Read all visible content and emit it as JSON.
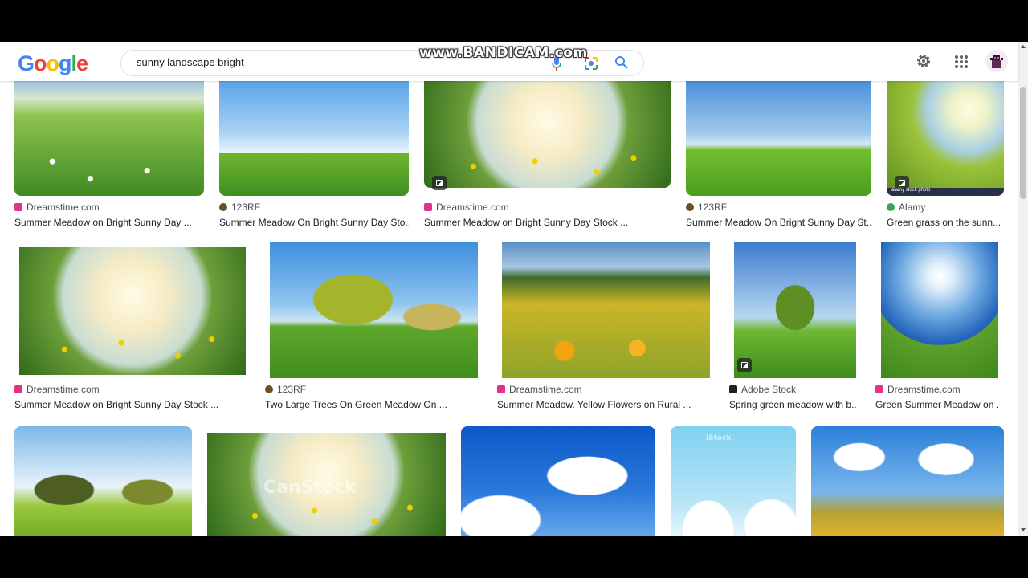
{
  "search": {
    "query": "sunny landscape bright"
  },
  "watermark": "www.BANDICAM.com",
  "logo": [
    "G",
    "o",
    "o",
    "g",
    "l",
    "e"
  ],
  "colors": {
    "source_icon_dreamstime": "#e0338a",
    "source_icon_123rf": "#6b4f2a",
    "source_icon_alamy": "#33a852",
    "source_icon_adobe": "#202124"
  },
  "results": [
    {
      "source": "Dreamstime.com",
      "title": "Summer Meadow on Bright Sunny Day ...",
      "icon": "dreamstime-icon"
    },
    {
      "source": "123RF",
      "title": "Summer Meadow On Bright Sunny Day Sto...",
      "icon": "123rf-icon"
    },
    {
      "source": "Dreamstime.com",
      "title": "Summer Meadow on Bright Sunny Day Stock ...",
      "icon": "dreamstime-icon"
    },
    {
      "source": "123RF",
      "title": "Summer Meadow On Bright Sunny Day St...",
      "icon": "123rf-icon"
    },
    {
      "source": "Alamy",
      "title": "Green grass on the sunn...",
      "icon": "alamy-icon",
      "overlay": "alamy stock photo"
    },
    {
      "source": "Dreamstime.com",
      "title": "Summer Meadow on Bright Sunny Day Stock ...",
      "icon": "dreamstime-icon"
    },
    {
      "source": "123RF",
      "title": "Two Large Trees On Green Meadow On ...",
      "icon": "123rf-icon"
    },
    {
      "source": "Dreamstime.com",
      "title": "Summer Meadow. Yellow Flowers on Rural ...",
      "icon": "dreamstime-icon"
    },
    {
      "source": "Adobe Stock",
      "title": "Spring green meadow with b...",
      "icon": "adobe-stock-icon"
    },
    {
      "source": "Dreamstime.com",
      "title": "Green Summer Meadow on ...",
      "icon": "dreamstime-icon"
    },
    {
      "overlay": "CanStock"
    },
    {
      "overlay": "iStock"
    }
  ]
}
